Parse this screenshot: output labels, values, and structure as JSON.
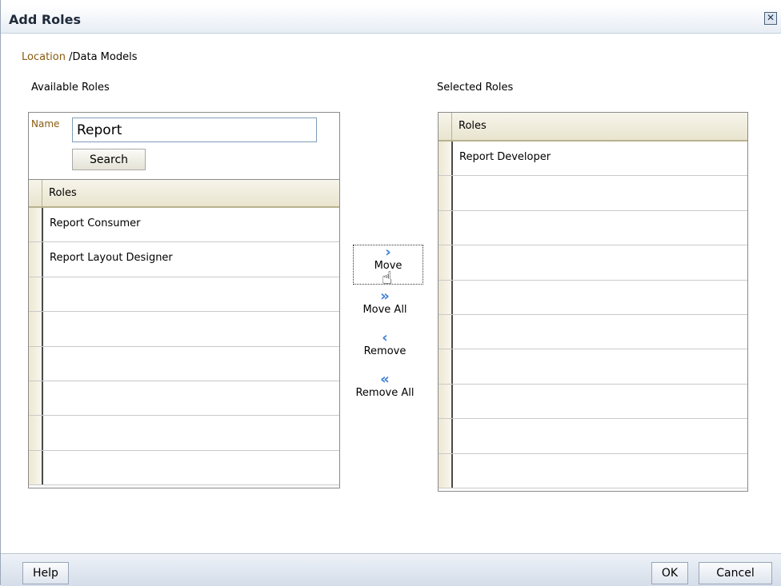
{
  "dialog": {
    "title": "Add Roles",
    "close_icon": "close-icon"
  },
  "location": {
    "label": "Location",
    "path": "/Data Models"
  },
  "available": {
    "heading": "Available Roles",
    "name_label": "Name",
    "name_value": "Report",
    "search_label": "Search",
    "column_header": "Roles",
    "rows": [
      "Report Consumer",
      "Report Layout Designer",
      "",
      "",
      "",
      "",
      "",
      ""
    ]
  },
  "shuttle": {
    "move": "Move",
    "move_all": "Move All",
    "remove": "Remove",
    "remove_all": "Remove All",
    "icons": {
      "move": "chevron-right-icon",
      "move_all": "double-chevron-right-icon",
      "remove": "chevron-left-icon",
      "remove_all": "double-chevron-left-icon"
    }
  },
  "selected": {
    "heading": "Selected Roles",
    "column_header": "Roles",
    "rows": [
      "Report Developer",
      "",
      "",
      "",
      "",
      "",
      "",
      "",
      "",
      ""
    ]
  },
  "footer": {
    "help": "Help",
    "ok": "OK",
    "cancel": "Cancel"
  },
  "colors": {
    "accent": "#3d7fd8",
    "label": "#8a5b10",
    "header": "#e8e4cf"
  }
}
